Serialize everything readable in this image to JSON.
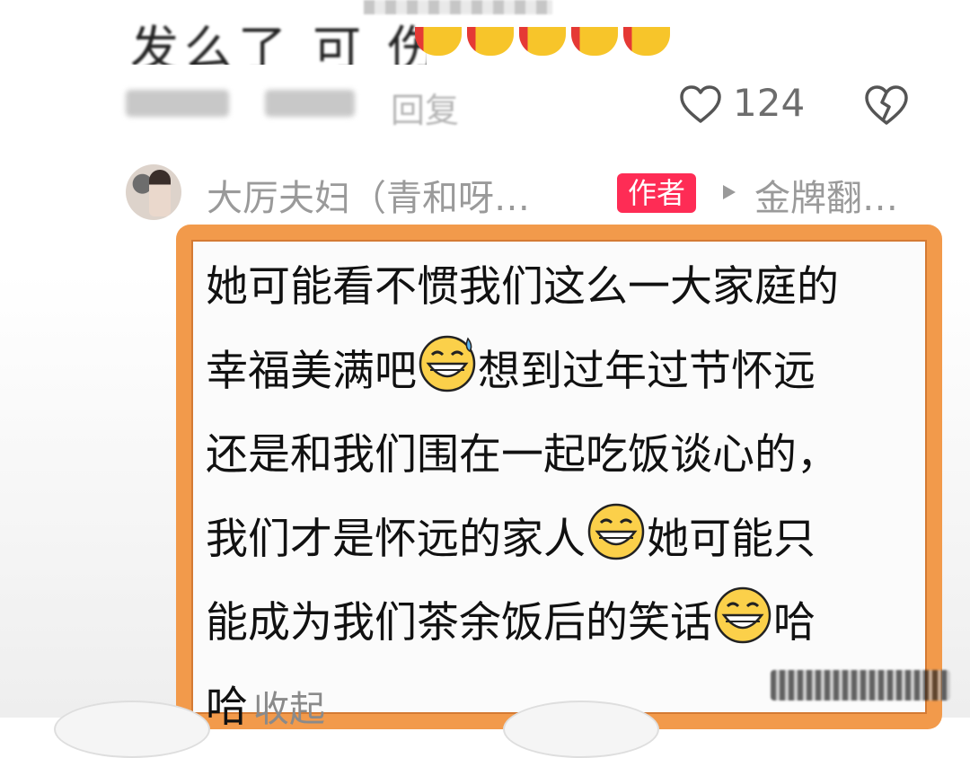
{
  "previous_comment": {
    "text_partial": "发么了 可 伤 仵",
    "reply_label": "回复",
    "like_count": "124"
  },
  "author_row": {
    "name": "大厉夫妇（青和呀…",
    "badge": "作者",
    "video_title": "金牌翻…"
  },
  "comment": {
    "lines": [
      "她可能看不惯我们这么一大家庭的",
      "幸福美满吧",
      "想到过年过节怀远",
      "还是和我们围在一起吃饭谈心的，",
      "我们才是怀远的家人",
      "她可能只",
      "能成为我们茶余饭后的笑话",
      "哈",
      "哈"
    ],
    "collapse_label": "收起"
  },
  "colors": {
    "accent_badge": "#fe2c55",
    "highlight_border": "#f29a4b",
    "meta_gray": "#9a9a9a"
  },
  "icons": [
    "heart-outline-icon",
    "broken-heart-icon",
    "play-triangle-icon",
    "grin-sweat-emoji",
    "grin-emoji"
  ]
}
